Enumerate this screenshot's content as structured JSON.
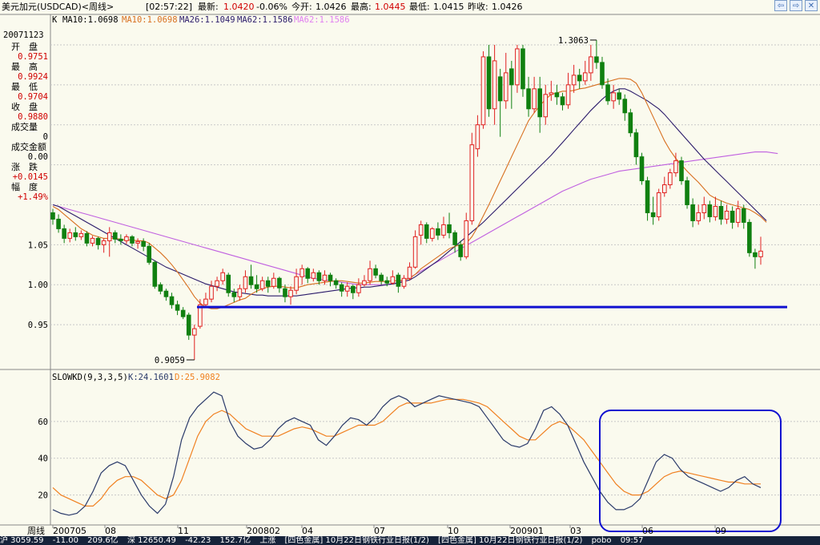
{
  "header": {
    "name": "美元加元(USDCAD)<周线>",
    "time": "[02:57:22]",
    "latest_label": "最新:",
    "latest": "1.0420",
    "change": "-0.06%",
    "open_label": "今开:",
    "open": "1.0426",
    "high_label": "最高:",
    "high": "1.0445",
    "low_label": "最低:",
    "low": "1.0415",
    "prev_label": "昨收:",
    "prev": "1.0426"
  },
  "ma_legend": {
    "k": "K",
    "ma10a": "MA10:1.0698",
    "ma10b": "MA10:1.0698",
    "ma26": "MA26:1.1049",
    "ma62": "MA62:1.1586"
  },
  "info": {
    "date": "20071123",
    "rows": [
      {
        "label": "开　盘",
        "value": "0.9751"
      },
      {
        "label": "最　高",
        "value": "0.9924"
      },
      {
        "label": "最　低",
        "value": "0.9704"
      },
      {
        "label": "收　盘",
        "value": "0.9880"
      },
      {
        "label": "成交量",
        "value": "0"
      },
      {
        "label": "成交金额",
        "value": "0.00"
      },
      {
        "label": "涨　跌",
        "value": "+0.0145"
      },
      {
        "label": "幅　度",
        "value": "+1.49%"
      }
    ]
  },
  "kdj_legend": {
    "name": "SLOWKD(9,3,3,5)",
    "k": "K:24.1601",
    "d": "D:25.9082"
  },
  "axis_left_label": "周线",
  "bottom_bar": [
    "沪 3059.59",
    "-11.00",
    "209.6亿",
    "深 12650.49",
    "-42.23",
    "152.7亿",
    "上涨",
    "[四色金属] 10月22日钢铁行业日报(1/2)",
    "[四色金属] 10月22日钢铁行业日报(1/2)",
    "pobo",
    "09:57"
  ],
  "colors": {
    "up": "#e02020",
    "down": "#108010",
    "ma10": "#d87020",
    "ma26": "#2a1a6a",
    "ma62": "#c060e0",
    "support": "#1010d0",
    "kline": "#2a3a6a",
    "dline": "#f08020",
    "grid": "#c8c8c8"
  },
  "chart_data": {
    "type": "candlestick",
    "title": "美元加元(USDCAD)<周线>",
    "ylim": [
      0.9,
      1.32
    ],
    "y_ticks": [
      "1.05",
      "1.00",
      "0.95"
    ],
    "x_ticks": [
      "200705",
      "08",
      "11",
      "200802",
      "04",
      "07",
      "10",
      "200901",
      "03",
      "06",
      "09"
    ],
    "annotations": {
      "high": "1.3063",
      "low": "0.9059",
      "support_level": 0.972
    },
    "candles": [
      [
        1.09,
        1.082,
        1.095,
        1.075
      ],
      [
        1.082,
        1.07,
        1.088,
        1.065
      ],
      [
        1.07,
        1.058,
        1.075,
        1.052
      ],
      [
        1.058,
        1.065,
        1.07,
        1.053
      ],
      [
        1.065,
        1.06,
        1.072,
        1.055
      ],
      [
        1.06,
        1.064,
        1.068,
        1.056
      ],
      [
        1.064,
        1.052,
        1.067,
        1.048
      ],
      [
        1.052,
        1.058,
        1.061,
        1.048
      ],
      [
        1.058,
        1.05,
        1.06,
        1.044
      ],
      [
        1.05,
        1.055,
        1.058,
        1.04
      ],
      [
        1.055,
        1.065,
        1.072,
        1.035
      ],
      [
        1.065,
        1.057,
        1.068,
        1.052
      ],
      [
        1.057,
        1.055,
        1.063,
        1.05
      ],
      [
        1.055,
        1.06,
        1.063,
        1.051
      ],
      [
        1.06,
        1.052,
        1.062,
        1.048
      ],
      [
        1.052,
        1.054,
        1.058,
        1.045
      ],
      [
        1.054,
        1.048,
        1.058,
        1.042
      ],
      [
        1.048,
        1.028,
        1.052,
        1.025
      ],
      [
        1.028,
        0.998,
        1.03,
        0.995
      ],
      [
        1.0,
        0.992,
        1.003,
        0.988
      ],
      [
        0.992,
        0.985,
        0.995,
        0.98
      ],
      [
        0.985,
        0.975,
        0.99,
        0.97
      ],
      [
        0.975,
        0.968,
        0.98,
        0.962
      ],
      [
        0.968,
        0.96,
        0.972,
        0.957
      ],
      [
        0.962,
        0.937,
        0.965,
        0.931
      ],
      [
        0.937,
        0.945,
        0.95,
        0.906
      ],
      [
        0.948,
        0.975,
        0.982,
        0.945
      ],
      [
        0.975,
        0.982,
        0.99,
        0.972
      ],
      [
        0.982,
        0.998,
        1.005,
        0.978
      ],
      [
        0.998,
        1.005,
        1.01,
        0.992
      ],
      [
        1.005,
        1.015,
        1.02,
        1.0
      ],
      [
        1.012,
        0.99,
        1.015,
        0.985
      ],
      [
        0.99,
        0.985,
        0.995,
        0.978
      ],
      [
        0.985,
        0.995,
        1.0,
        0.98
      ],
      [
        0.995,
        1.01,
        1.018,
        0.99
      ],
      [
        1.01,
        1.0,
        1.025,
        0.995
      ],
      [
        1.0,
        0.995,
        1.012,
        0.99
      ],
      [
        0.995,
        1.005,
        1.01,
        0.992
      ],
      [
        1.005,
        0.998,
        1.01,
        0.99
      ],
      [
        0.998,
        1.008,
        1.015,
        0.995
      ],
      [
        1.008,
        0.996,
        1.01,
        0.99
      ],
      [
        0.995,
        0.985,
        1.0,
        0.978
      ],
      [
        0.985,
        0.993,
        0.998,
        0.975
      ],
      [
        0.993,
        1.01,
        1.02,
        0.988
      ],
      [
        1.01,
        1.02,
        1.025,
        1.0
      ],
      [
        1.02,
        1.008,
        1.022,
        1.002
      ],
      [
        1.008,
        1.015,
        1.02,
        1.004
      ],
      [
        1.015,
        1.005,
        1.018,
        1.0
      ],
      [
        1.005,
        1.012,
        1.018,
        1.0
      ],
      [
        1.012,
        1.005,
        1.015,
        0.998
      ],
      [
        1.005,
        1.0,
        1.008,
        0.995
      ],
      [
        1.0,
        0.992,
        1.003,
        0.985
      ],
      [
        0.992,
        0.998,
        1.003,
        0.985
      ],
      [
        0.998,
        0.99,
        1.0,
        0.982
      ],
      [
        0.99,
        1.0,
        1.008,
        0.985
      ],
      [
        1.0,
        1.005,
        1.012,
        0.998
      ],
      [
        1.005,
        1.02,
        1.03,
        1.0
      ],
      [
        1.02,
        1.012,
        1.025,
        1.008
      ],
      [
        1.012,
        1.005,
        1.015,
        1.0
      ],
      [
        1.005,
        1.002,
        1.01,
        0.998
      ],
      [
        1.002,
        1.01,
        1.018,
        1.0
      ],
      [
        1.012,
        0.998,
        1.015,
        0.99
      ],
      [
        0.998,
        1.008,
        1.012,
        0.995
      ],
      [
        1.008,
        1.022,
        1.028,
        1.005
      ],
      [
        1.022,
        1.06,
        1.068,
        1.02
      ],
      [
        1.062,
        1.075,
        1.08,
        1.05
      ],
      [
        1.075,
        1.058,
        1.078,
        1.052
      ],
      [
        1.058,
        1.07,
        1.072,
        1.054
      ],
      [
        1.07,
        1.062,
        1.078,
        1.056
      ],
      [
        1.062,
        1.075,
        1.085,
        1.058
      ],
      [
        1.075,
        1.065,
        1.09,
        1.058
      ],
      [
        1.065,
        1.05,
        1.068,
        1.04
      ],
      [
        1.05,
        1.035,
        1.055,
        1.03
      ],
      [
        1.035,
        1.08,
        1.09,
        1.032
      ],
      [
        1.08,
        1.175,
        1.19,
        1.075
      ],
      [
        1.17,
        1.2,
        1.212,
        1.16
      ],
      [
        1.2,
        1.285,
        1.292,
        1.195
      ],
      [
        1.285,
        1.22,
        1.3,
        1.21
      ],
      [
        1.22,
        1.28,
        1.3,
        1.2
      ],
      [
        1.26,
        1.23,
        1.27,
        1.185
      ],
      [
        1.23,
        1.265,
        1.29,
        1.22
      ],
      [
        1.27,
        1.25,
        1.28,
        1.22
      ],
      [
        1.25,
        1.295,
        1.3,
        1.24
      ],
      [
        1.295,
        1.245,
        1.3,
        1.235
      ],
      [
        1.245,
        1.22,
        1.26,
        1.21
      ],
      [
        1.22,
        1.245,
        1.26,
        1.215
      ],
      [
        1.245,
        1.21,
        1.26,
        1.19
      ],
      [
        1.21,
        1.238,
        1.25,
        1.2
      ],
      [
        1.238,
        1.24,
        1.255,
        1.23
      ],
      [
        1.24,
        1.235,
        1.25,
        1.225
      ],
      [
        1.235,
        1.225,
        1.24,
        1.218
      ],
      [
        1.225,
        1.25,
        1.265,
        1.22
      ],
      [
        1.25,
        1.262,
        1.275,
        1.24
      ],
      [
        1.262,
        1.255,
        1.27,
        1.245
      ],
      [
        1.255,
        1.265,
        1.28,
        1.25
      ],
      [
        1.265,
        1.285,
        1.3,
        1.255
      ],
      [
        1.285,
        1.278,
        1.306,
        1.27
      ],
      [
        1.278,
        1.25,
        1.285,
        1.245
      ],
      [
        1.25,
        1.23,
        1.258,
        1.225
      ],
      [
        1.23,
        1.24,
        1.25,
        1.22
      ],
      [
        1.24,
        1.232,
        1.245,
        1.225
      ],
      [
        1.232,
        1.215,
        1.238,
        1.205
      ],
      [
        1.215,
        1.19,
        1.22,
        1.185
      ],
      [
        1.19,
        1.16,
        1.195,
        1.15
      ],
      [
        1.16,
        1.13,
        1.165,
        1.125
      ],
      [
        1.13,
        1.09,
        1.135,
        1.08
      ],
      [
        1.09,
        1.085,
        1.11,
        1.075
      ],
      [
        1.085,
        1.115,
        1.12,
        1.08
      ],
      [
        1.115,
        1.125,
        1.135,
        1.11
      ],
      [
        1.125,
        1.14,
        1.145,
        1.12
      ],
      [
        1.14,
        1.155,
        1.165,
        1.135
      ],
      [
        1.155,
        1.13,
        1.16,
        1.125
      ],
      [
        1.13,
        1.1,
        1.135,
        1.095
      ],
      [
        1.1,
        1.08,
        1.108,
        1.072
      ],
      [
        1.08,
        1.09,
        1.1,
        1.075
      ],
      [
        1.09,
        1.1,
        1.11,
        1.082
      ],
      [
        1.1,
        1.085,
        1.105,
        1.078
      ],
      [
        1.085,
        1.098,
        1.11,
        1.08
      ],
      [
        1.098,
        1.082,
        1.105,
        1.075
      ],
      [
        1.082,
        1.092,
        1.1,
        1.076
      ],
      [
        1.092,
        1.078,
        1.098,
        1.07
      ],
      [
        1.078,
        1.095,
        1.105,
        1.072
      ],
      [
        1.095,
        1.078,
        1.1,
        1.07
      ],
      [
        1.078,
        1.04,
        1.082,
        1.035
      ],
      [
        1.04,
        1.035,
        1.045,
        1.02
      ],
      [
        1.035,
        1.042,
        1.06,
        1.025
      ]
    ],
    "ma10": [
      1.098,
      1.094,
      1.088,
      1.082,
      1.076,
      1.07,
      1.066,
      1.062,
      1.06,
      1.058,
      1.058,
      1.058,
      1.057,
      1.056,
      1.056,
      1.055,
      1.055,
      1.052,
      1.046,
      1.04,
      1.033,
      1.025,
      1.016,
      1.006,
      0.996,
      0.985,
      0.977,
      0.972,
      0.97,
      0.97,
      0.972,
      0.975,
      0.978,
      0.981,
      0.983,
      0.988,
      0.992,
      0.995,
      0.997,
      0.998,
      0.998,
      0.997,
      0.996,
      0.996,
      0.998,
      1.0,
      1.001,
      1.002,
      1.003,
      1.004,
      1.005,
      1.005,
      1.004,
      1.003,
      1.002,
      1.002,
      1.003,
      1.004,
      1.004,
      1.004,
      1.005,
      1.005,
      1.006,
      1.008,
      1.013,
      1.02,
      1.025,
      1.03,
      1.035,
      1.04,
      1.045,
      1.048,
      1.05,
      1.052,
      1.06,
      1.072,
      1.086,
      1.1,
      1.115,
      1.13,
      1.145,
      1.16,
      1.175,
      1.19,
      1.205,
      1.215,
      1.224,
      1.232,
      1.238,
      1.24,
      1.242,
      1.242,
      1.243,
      1.245,
      1.246,
      1.248,
      1.25,
      1.252,
      1.254,
      1.256,
      1.258,
      1.258,
      1.257,
      1.252,
      1.24,
      1.225,
      1.21,
      1.195,
      1.18,
      1.168,
      1.158,
      1.15,
      1.142,
      1.135,
      1.128,
      1.12,
      1.112,
      1.108,
      1.105,
      1.102,
      1.1,
      1.098,
      1.096,
      1.094,
      1.09,
      1.085,
      1.078
    ],
    "ma26": [
      1.1,
      1.098,
      1.094,
      1.09,
      1.086,
      1.082,
      1.078,
      1.074,
      1.07,
      1.066,
      1.062,
      1.058,
      1.054,
      1.05,
      1.046,
      1.042,
      1.038,
      1.034,
      1.03,
      1.026,
      1.022,
      1.019,
      1.016,
      1.013,
      1.01,
      1.007,
      1.004,
      1.001,
      0.999,
      0.997,
      0.995,
      0.993,
      0.991,
      0.99,
      0.989,
      0.988,
      0.987,
      0.987,
      0.986,
      0.986,
      0.986,
      0.986,
      0.986,
      0.986,
      0.987,
      0.988,
      0.989,
      0.99,
      0.991,
      0.992,
      0.993,
      0.994,
      0.995,
      0.996,
      0.996,
      0.997,
      0.997,
      0.998,
      0.999,
      1.0,
      1.001,
      1.002,
      1.004,
      1.006,
      1.01,
      1.015,
      1.02,
      1.025,
      1.03,
      1.036,
      1.042,
      1.048,
      1.054,
      1.06,
      1.066,
      1.072,
      1.078,
      1.085,
      1.092,
      1.099,
      1.106,
      1.113,
      1.12,
      1.127,
      1.134,
      1.141,
      1.148,
      1.155,
      1.162,
      1.17,
      1.178,
      1.186,
      1.194,
      1.202,
      1.21,
      1.218,
      1.225,
      1.232,
      1.238,
      1.242,
      1.245,
      1.245,
      1.242,
      1.238,
      1.234,
      1.23,
      1.225,
      1.22,
      1.213,
      1.205,
      1.197,
      1.189,
      1.181,
      1.173,
      1.165,
      1.157,
      1.15,
      1.143,
      1.136,
      1.129,
      1.122,
      1.115,
      1.108,
      1.101,
      1.094,
      1.087,
      1.08
    ],
    "ma62": [
      1.1,
      1.098,
      1.096,
      1.094,
      1.092,
      1.09,
      1.088,
      1.086,
      1.084,
      1.082,
      1.08,
      1.078,
      1.076,
      1.074,
      1.072,
      1.07,
      1.068,
      1.066,
      1.064,
      1.062,
      1.06,
      1.058,
      1.056,
      1.054,
      1.052,
      1.05,
      1.048,
      1.046,
      1.044,
      1.042,
      1.04,
      1.038,
      1.036,
      1.034,
      1.032,
      1.03,
      1.028,
      1.026,
      1.024,
      1.022,
      1.02,
      1.018,
      1.016,
      1.014,
      1.012,
      1.01,
      1.008,
      1.007,
      1.006,
      1.005,
      1.004,
      1.003,
      1.002,
      1.001,
      1.0,
      1.0,
      1.0,
      1.0,
      1.0,
      1.0,
      1.001,
      1.003,
      1.006,
      1.009,
      1.013,
      1.017,
      1.021,
      1.025,
      1.029,
      1.033,
      1.037,
      1.041,
      1.045,
      1.049,
      1.053,
      1.057,
      1.061,
      1.065,
      1.069,
      1.073,
      1.077,
      1.081,
      1.085,
      1.089,
      1.093,
      1.097,
      1.101,
      1.105,
      1.109,
      1.113,
      1.117,
      1.12,
      1.123,
      1.126,
      1.129,
      1.132,
      1.134,
      1.136,
      1.138,
      1.14,
      1.142,
      1.143,
      1.144,
      1.145,
      1.146,
      1.147,
      1.148,
      1.149,
      1.15,
      1.151,
      1.152,
      1.153,
      1.154,
      1.155,
      1.156,
      1.157,
      1.158,
      1.159,
      1.16,
      1.161,
      1.162,
      1.163,
      1.164,
      1.165,
      1.166,
      1.166,
      1.166,
      1.165,
      1.164
    ],
    "kd": {
      "ylim": [
        5,
        80
      ],
      "y_ticks": [
        "60",
        "40",
        "20"
      ],
      "k": [
        12,
        10,
        9,
        10,
        14,
        22,
        32,
        36,
        38,
        36,
        28,
        20,
        14,
        10,
        15,
        30,
        50,
        62,
        68,
        72,
        76,
        74,
        60,
        52,
        48,
        45,
        46,
        50,
        56,
        60,
        62,
        60,
        58,
        50,
        47,
        52,
        58,
        62,
        61,
        58,
        62,
        68,
        72,
        74,
        72,
        68,
        70,
        72,
        74,
        73,
        72,
        71,
        70,
        68,
        62,
        56,
        50,
        47,
        46,
        48,
        56,
        66,
        68,
        64,
        58,
        48,
        38,
        30,
        22,
        16,
        12,
        12,
        14,
        18,
        28,
        38,
        42,
        40,
        34,
        30,
        28,
        26,
        24,
        22,
        24,
        28,
        30,
        26,
        24
      ],
      "d": [
        24,
        20,
        18,
        16,
        14,
        14,
        18,
        24,
        28,
        30,
        30,
        28,
        24,
        20,
        18,
        20,
        28,
        40,
        52,
        60,
        64,
        66,
        64,
        60,
        56,
        54,
        52,
        52,
        52,
        54,
        56,
        57,
        56,
        54,
        52,
        52,
        54,
        56,
        58,
        58,
        58,
        60,
        64,
        68,
        70,
        70,
        70,
        70,
        71,
        72,
        72,
        72,
        71,
        70,
        68,
        64,
        60,
        56,
        52,
        50,
        50,
        54,
        58,
        60,
        58,
        54,
        50,
        44,
        38,
        32,
        26,
        22,
        20,
        20,
        22,
        26,
        30,
        32,
        33,
        32,
        31,
        30,
        29,
        28,
        27,
        27,
        26,
        26,
        26
      ]
    }
  }
}
